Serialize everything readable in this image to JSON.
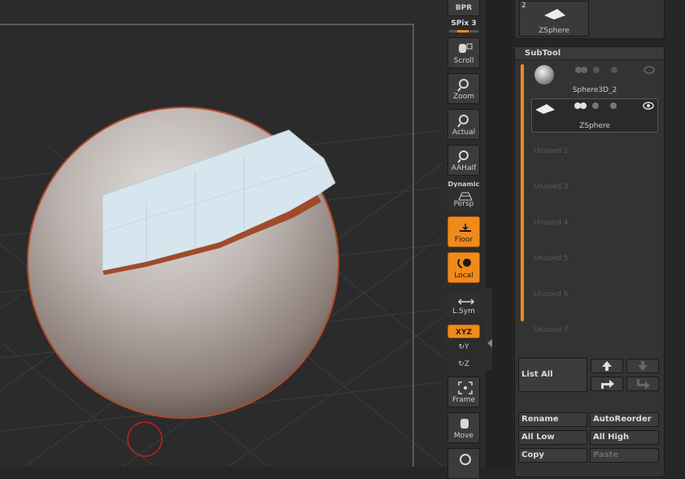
{
  "shelf": {
    "bpr": "BPR",
    "spix": "SPix 3",
    "scroll": "Scroll",
    "zoom": "Zoom",
    "actual": "Actual",
    "aahalf": "AAHalf",
    "dynamic": "Dynamic",
    "persp": "Persp",
    "floor": "Floor",
    "local": "Local",
    "lsym": "L.Sym",
    "xyz": "XYZ",
    "y": "Y",
    "z": "Z",
    "frame": "Frame",
    "move": "Move"
  },
  "tool_thumb": {
    "count": "2",
    "name": "ZSphere"
  },
  "subtool": {
    "title": "SubTool",
    "items": [
      {
        "name": "Sphere3D_2"
      },
      {
        "name": "ZSphere"
      }
    ],
    "unused": [
      "Unused 2",
      "Unused 3",
      "Unused 4",
      "Unused 5",
      "Unused 6",
      "Unused 7"
    ],
    "list_all": "List All",
    "rename": "Rename",
    "autoreorder": "AutoReorder",
    "all_low": "All Low",
    "all_high": "All High",
    "copy": "Copy",
    "paste": "Paste"
  },
  "colors": {
    "accent": "#f08a1a",
    "panel": "#333333",
    "viewport": "#2b2b2b"
  }
}
